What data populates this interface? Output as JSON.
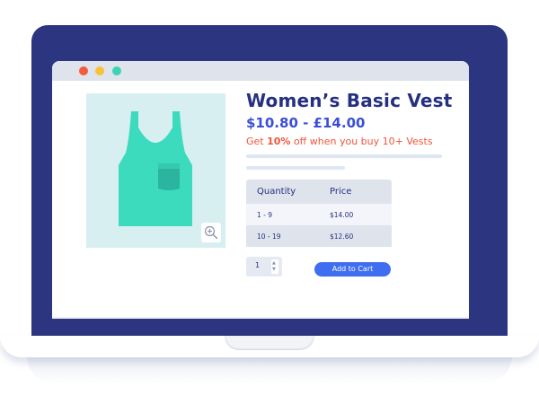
{
  "window": {
    "controls": [
      "close",
      "minimize",
      "maximize"
    ]
  },
  "product": {
    "title": "Women’s Basic Vest",
    "price_range": "$10.80 - £14.00",
    "promo": {
      "prefix": "Get ",
      "highlight": "10%",
      "suffix": " off when you buy 10+ Vests"
    },
    "image": {
      "icon": "vest-icon",
      "zoom_icon": "zoom-in-icon",
      "background_color": "#d8eff2",
      "vest_color": "#3ddbbd"
    }
  },
  "pricing_table": {
    "headers": [
      "Quantity",
      "Price"
    ],
    "rows": [
      {
        "quantity": "1 - 9",
        "price": "$14.00"
      },
      {
        "quantity": "10 - 19",
        "price": "$12.60"
      }
    ]
  },
  "cart": {
    "quantity_value": "1",
    "add_to_cart_label": "Add to Cart"
  },
  "colors": {
    "laptop_frame": "#2b3580",
    "title": "#263080",
    "price": "#3a4fd6",
    "promo": "#f0553a",
    "button": "#3f6ef0"
  }
}
